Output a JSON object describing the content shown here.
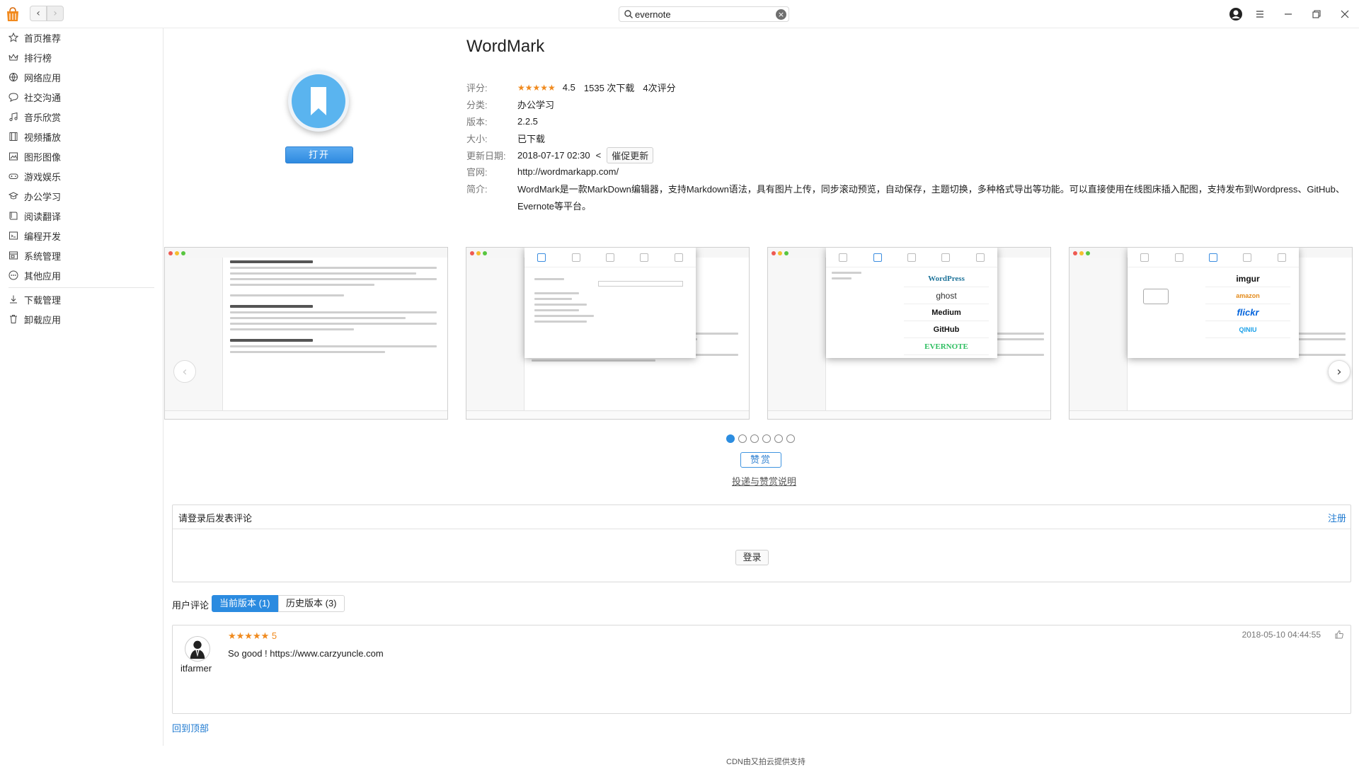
{
  "search": {
    "value": "evernote",
    "placeholder": ""
  },
  "sidebar": {
    "items": [
      {
        "label": "首页推荐",
        "icon": "star-icon"
      },
      {
        "label": "排行榜",
        "icon": "crown-icon"
      },
      {
        "label": "网络应用",
        "icon": "globe-icon"
      },
      {
        "label": "社交沟通",
        "icon": "chat-icon"
      },
      {
        "label": "音乐欣赏",
        "icon": "music-note-icon"
      },
      {
        "label": "视频播放",
        "icon": "film-icon"
      },
      {
        "label": "图形图像",
        "icon": "image-icon"
      },
      {
        "label": "游戏娱乐",
        "icon": "gamepad-icon"
      },
      {
        "label": "办公学习",
        "icon": "graduation-cap-icon"
      },
      {
        "label": "阅读翻译",
        "icon": "book-icon"
      },
      {
        "label": "编程开发",
        "icon": "code-icon"
      },
      {
        "label": "系统管理",
        "icon": "system-icon"
      },
      {
        "label": "其他应用",
        "icon": "more-dots-icon"
      },
      {
        "label": "下载管理",
        "icon": "download-icon"
      },
      {
        "label": "卸载应用",
        "icon": "trash-icon"
      }
    ]
  },
  "app": {
    "name": "WordMark",
    "open_label": "打开",
    "rating_label": "评分:",
    "rating_stars": "★★★★★",
    "rating_value": "4.5",
    "downloads": "1535 次下载",
    "rating_count": "4次评分",
    "category_label": "分类:",
    "category": "办公学习",
    "version_label": "版本:",
    "version": "2.2.5",
    "size_label": "大小:",
    "size": "已下载",
    "update_label": "更新日期:",
    "update_date": "2018-07-17 02:30",
    "update_arrow": "<",
    "urge_update": "催促更新",
    "website_label": "官网:",
    "website": "http://wordmarkapp.com/",
    "intro_label": "简介:",
    "intro": "WordMark是一款MarkDown编辑器，支持Markdown语法，具有图片上传，同步滚动预览，自动保存，主题切换，多种格式导出等功能。可以直接使用在线图床插入配图，支持发布到Wordpress、GitHub、Evernote等平台。"
  },
  "carousel": {
    "prev_icon": "chevron-left-icon",
    "next_icon": "chevron-right-icon",
    "dot_count": 6,
    "active_dot": 0,
    "shot2_logos": [
      "WordPress",
      "ghost",
      "Medium",
      "GitHub",
      "EVERNOTE"
    ],
    "shot3_logos": [
      "imgur",
      "amazon",
      "flickr",
      "QINIU"
    ]
  },
  "donate": {
    "button": "赞赏",
    "link": "投递与赞赏说明"
  },
  "comment": {
    "prompt": "请登录后发表评论",
    "register": "注册",
    "login": "登录"
  },
  "reviews": {
    "label": "用户评论",
    "tab_current": "当前版本 (1)",
    "tab_history": "历史版本 (3)",
    "items": [
      {
        "user": "itfarmer",
        "stars": "★★★★★ 5",
        "text": "So good ! https://www.carzyuncle.com",
        "date": "2018-05-10 04:44:55"
      }
    ]
  },
  "footer": {
    "back_to_top": "回到顶部",
    "cdn_note": "CDN由又拍云提供支持"
  },
  "colors": {
    "accent": "#2b8be0",
    "star": "#f08a1e",
    "app_icon": "#5ab4ef"
  }
}
